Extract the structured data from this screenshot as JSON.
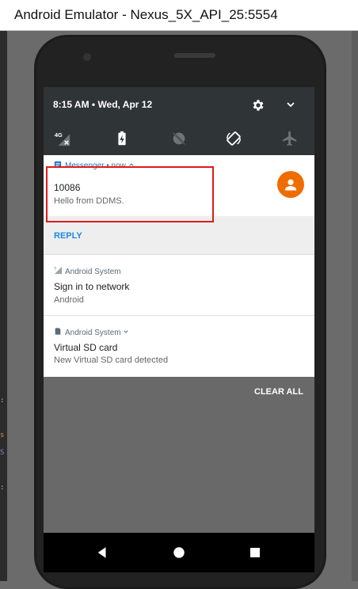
{
  "window": {
    "title": "Android Emulator - Nexus_5X_API_25:5554"
  },
  "status_header": {
    "time_date": "8:15 AM • Wed, Apr 12",
    "icons": [
      "settings-gear-icon",
      "expand-chevron-icon"
    ]
  },
  "quick_tiles": [
    {
      "name": "network-4g-icon",
      "label": "4G"
    },
    {
      "name": "battery-saver-icon"
    },
    {
      "name": "do-not-disturb-icon"
    },
    {
      "name": "auto-rotate-icon"
    },
    {
      "name": "airplane-mode-icon"
    }
  ],
  "notifications": [
    {
      "app": "Messenger",
      "when": "• now",
      "title": "10086",
      "text": "Hello from DDMS.",
      "icon": "message-icon",
      "action": "REPLY",
      "accent": "#1e73be",
      "avatar_color": "#ef6c00"
    },
    {
      "app": "Android System",
      "title": "Sign in to network",
      "text": "Android",
      "icon": "wifi-signal-icon"
    },
    {
      "app": "Android System",
      "title": "Virtual SD card",
      "text": "New Virtual SD card detected",
      "icon": "sd-card-icon"
    }
  ],
  "clear_all_label": "CLEAR ALL",
  "nav": [
    "back-icon",
    "home-icon",
    "recents-icon"
  ],
  "colors": {
    "highlight": "#e01a1a",
    "panel_header": "#2f3437",
    "reply_bar": "#eeeeee"
  }
}
